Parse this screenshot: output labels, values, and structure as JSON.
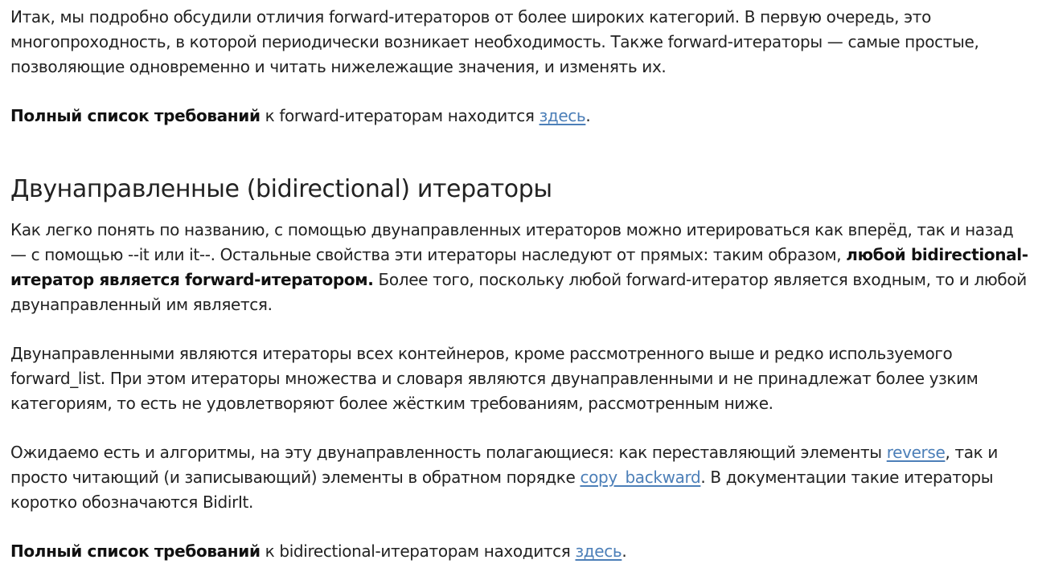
{
  "intro": {
    "text": "Итак, мы подробно обсудили отличия forward-итераторов от более широких категорий. В первую очередь, это многопроходность, в которой периодически возникает необходимость. Также forward-итераторы — самые простые, позволяющие одновременно и читать нижележащие значения, и изменять их."
  },
  "forward_req": {
    "bold": "Полный список требований",
    "text": " к forward-итераторам находится ",
    "link": "здесь",
    "end": "."
  },
  "section": {
    "heading": "Двунаправленные (bidirectional) итераторы",
    "p1": {
      "text1": "Как легко понять по названию, с помощью двунаправленных итераторов можно итерироваться как вперёд, так и назад — с помощью --it или it--. Остальные свойства эти итераторы наследуют от прямых: таким образом, ",
      "bold": "любой bidirectional-итератор является forward-итератором.",
      "text2": " Более того, поскольку любой forward-итератор является входным, то и любой двунаправленный им является."
    },
    "p2": {
      "text": "Двунаправленными являются итераторы всех контейнеров, кроме рассмотренного выше и редко используемого forward_list. При этом итераторы множества и словаря являются двунаправленными и не принадлежат более узким категориям, то есть не удовлетворяют более жёстким требованиям, рассмотренным ниже."
    },
    "p3": {
      "text1": "Ожидаемо есть и алгоритмы, на эту двунаправленность полагающиеся: как переставляющий элементы ",
      "link1": "reverse",
      "text2": ", так и просто читающий (и записывающий) элементы в обратном порядке ",
      "link2": "copy_backward",
      "text3": ". В документации такие итераторы коротко обозначаются BidirIt."
    },
    "req": {
      "bold": "Полный список требований",
      "text": " к bidirectional-итераторам находится ",
      "link": "здесь",
      "end": "."
    }
  },
  "colors": {
    "text": "#222222",
    "link": "#4c7fb8",
    "background": "#ffffff"
  }
}
